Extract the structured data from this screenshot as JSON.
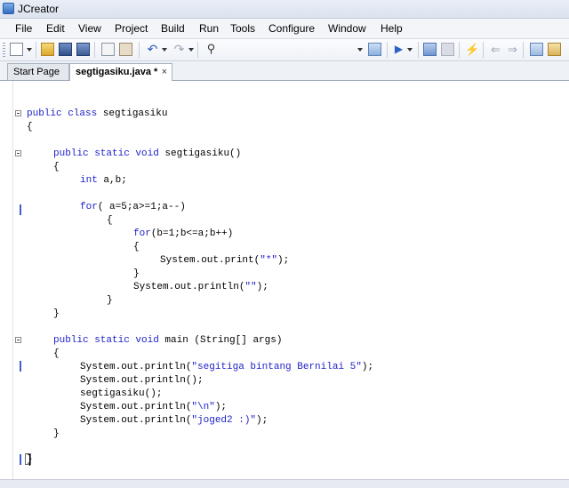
{
  "window": {
    "title": "JCreator"
  },
  "menu": [
    "File",
    "Edit",
    "View",
    "Project",
    "Build",
    "Run",
    "Tools",
    "Configure",
    "Window",
    "Help"
  ],
  "toolbar": {
    "icons": [
      "new-file-icon",
      "open-folder-icon",
      "save-icon",
      "save-all-icon",
      "copy-icon",
      "paste-icon",
      "undo-icon",
      "redo-icon",
      "find-icon",
      "config-dropdown",
      "compile-icon",
      "run-icon",
      "debug-icon",
      "stop-icon",
      "breakpoint-icon",
      "back-icon",
      "forward-icon",
      "output-icon",
      "workspace-icon"
    ]
  },
  "tabs": [
    {
      "label": "Start Page",
      "active": false
    },
    {
      "label": "segtigasiku.java *",
      "active": true,
      "close": "×"
    }
  ],
  "code": {
    "l1": {
      "kw": "public class",
      "rest": " segtigasiku"
    },
    "l2": "{",
    "l3": {
      "kw": "public static void",
      "rest": " segtigasiku()"
    },
    "l4": "{",
    "l5": {
      "kw": "int",
      "rest": " a,b;"
    },
    "l6": {
      "kw": "for",
      "rest": "( a=5;a>=1;a--)"
    },
    "l7": "{",
    "l8": {
      "kw": "for",
      "rest": "(b=1;b<=a;b++)"
    },
    "l9": "{",
    "l10": {
      "pre": "System.out.print(",
      "str": "\"*\"",
      "post": ");"
    },
    "l11": "}",
    "l12": {
      "pre": "System.out.println(",
      "str": "\"\"",
      "post": ");"
    },
    "l13": "}",
    "l14": "}",
    "l15": {
      "kw": "public static void",
      "rest": " main (String[] args)"
    },
    "l16": "{",
    "l17": {
      "pre": "System.out.println(",
      "str": "\"segitiga bintang Bernilai 5\"",
      "post": ");"
    },
    "l18": "System.out.println();",
    "l19": "segtigasiku();",
    "l20": {
      "pre": "System.out.println(",
      "str": "\"\\n\"",
      "post": ");"
    },
    "l21": {
      "pre": "System.out.println(",
      "str": "\"joged2 :)\"",
      "post": ");"
    },
    "l22": "}",
    "l23": "}"
  }
}
